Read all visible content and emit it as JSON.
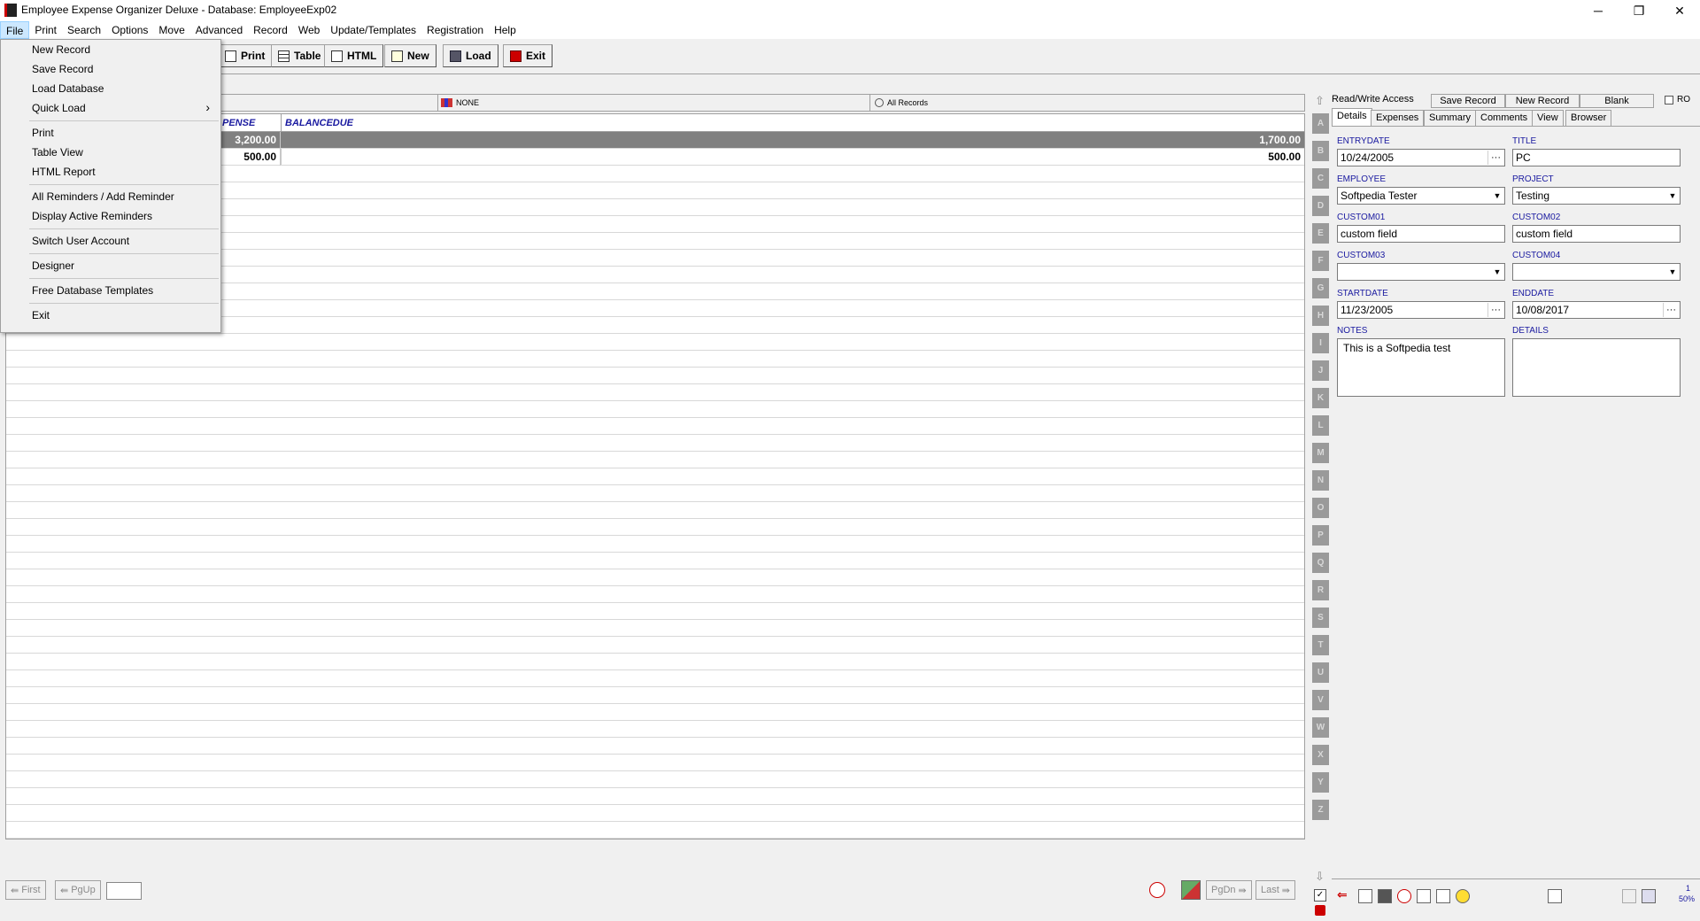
{
  "window": {
    "title": "Employee Expense Organizer Deluxe - Database: EmployeeExp02",
    "minimize": "─",
    "restore": "❐",
    "close": "✕"
  },
  "menubar": [
    "File",
    "Print",
    "Search",
    "Options",
    "Move",
    "Advanced",
    "Record",
    "Web",
    "Update/Templates",
    "Registration",
    "Help"
  ],
  "toolbar": {
    "print": "Print",
    "table": "Table",
    "html": "HTML",
    "new": "New",
    "load": "Load",
    "exit": "Exit"
  },
  "filterbar": {
    "filter1": "NONE",
    "filter2": "All Records"
  },
  "grid": {
    "headers": [
      "PENSE",
      "BALANCEDUE"
    ],
    "rows": [
      {
        "expense": "3,200.00",
        "balance": "1,700.00",
        "selected": true
      },
      {
        "expense": "500.00",
        "balance": "500.00",
        "selected": false
      }
    ]
  },
  "file_menu": {
    "items": [
      "New Record",
      "Save Record",
      "Load Database",
      "Quick Load",
      "Print",
      "Table View",
      "HTML Report",
      "All Reminders / Add Reminder",
      "Display Active Reminders",
      "Switch User Account",
      "Designer",
      "Free Database Templates",
      "Exit"
    ],
    "submenu_arrow": "›"
  },
  "alpha_index": [
    "A",
    "B",
    "C",
    "D",
    "E",
    "F",
    "G",
    "H",
    "I",
    "J",
    "K",
    "L",
    "M",
    "N",
    "O",
    "P",
    "Q",
    "R",
    "S",
    "T",
    "U",
    "V",
    "W",
    "X",
    "Y",
    "Z"
  ],
  "right_panel": {
    "access": "Read/Write Access",
    "save_record": "Save Record",
    "new_record": "New Record",
    "blank": "Blank",
    "ro": "RO",
    "tabs": [
      "Details",
      "Expenses",
      "Summary",
      "Comments",
      "View",
      "Browser"
    ],
    "fields": {
      "entrydate_label": "ENTRYDATE",
      "entrydate": "10/24/2005",
      "title_label": "TITLE",
      "title": "PC",
      "employee_label": "EMPLOYEE",
      "employee": "Softpedia Tester",
      "project_label": "PROJECT",
      "project": "Testing",
      "custom01_label": "CUSTOM01",
      "custom01": "custom field",
      "custom02_label": "CUSTOM02",
      "custom02": "custom field",
      "custom03_label": "CUSTOM03",
      "custom03": "",
      "custom04_label": "CUSTOM04",
      "custom04": "",
      "startdate_label": "STARTDATE",
      "startdate": "11/23/2005",
      "enddate_label": "ENDDATE",
      "enddate": "10/08/2017",
      "notes_label": "NOTES",
      "notes": "This is a Softpedia test",
      "details_label": "DETAILS",
      "details": ""
    },
    "zoom": "50%",
    "page_no": "1"
  },
  "nav": {
    "first": "First",
    "pgup": "PgUp",
    "pgdn": "PgDn",
    "last": "Last"
  }
}
